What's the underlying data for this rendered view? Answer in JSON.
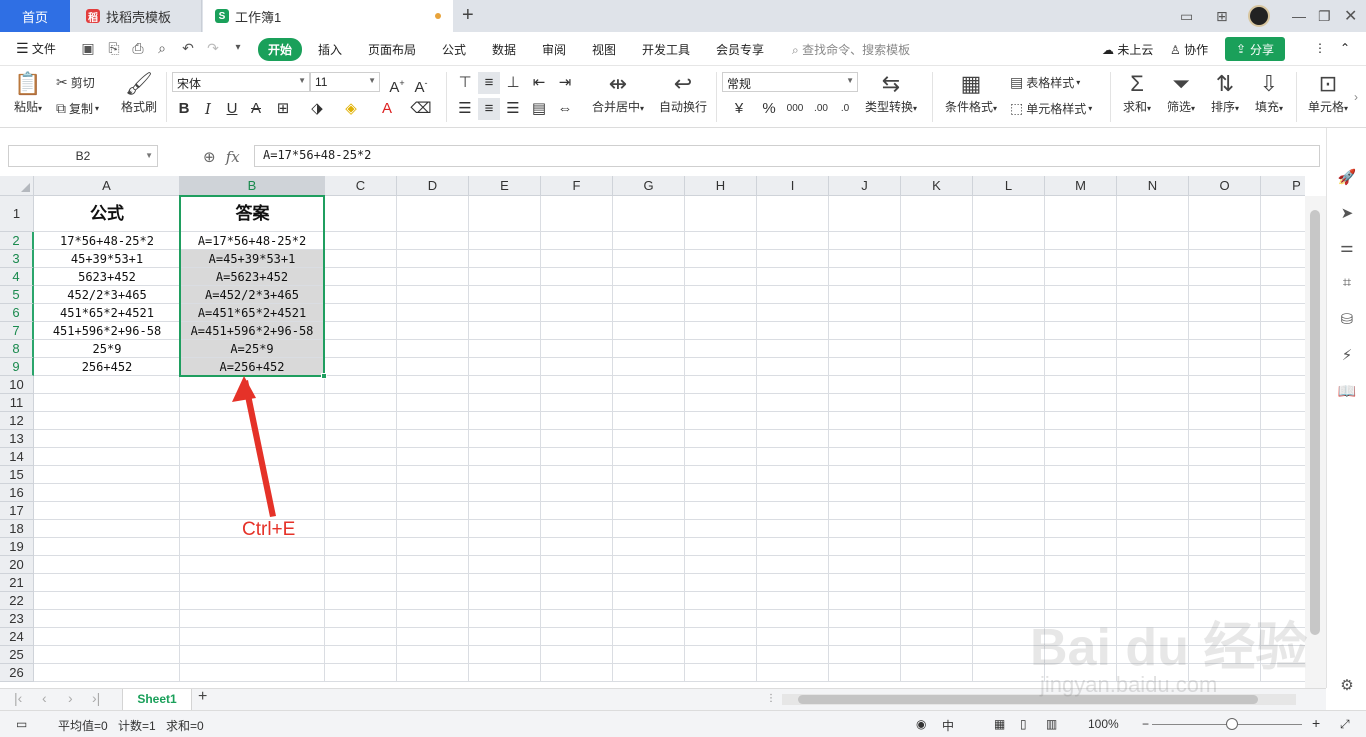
{
  "tabs": {
    "home": "首页",
    "template": "找稻壳模板",
    "workbook": "工作簿1"
  },
  "menu": {
    "file": "文件",
    "items": [
      "开始",
      "插入",
      "页面布局",
      "公式",
      "数据",
      "审阅",
      "视图",
      "开发工具",
      "会员专享"
    ],
    "search": "查找命令、搜索模板",
    "cloud": "未上云",
    "collab": "协作",
    "share": "分享"
  },
  "ribbon": {
    "paste": "粘贴",
    "cut": "剪切",
    "copy": "复制",
    "format_painter": "格式刷",
    "font_name": "宋体",
    "font_size": "11",
    "merge_center": "合并居中",
    "wrap_text": "自动换行",
    "number_format": "常规",
    "type_convert": "类型转换",
    "cond_format": "条件格式",
    "table_style": "表格样式",
    "cell_style": "单元格样式",
    "sum": "求和",
    "filter": "筛选",
    "sort": "排序",
    "fill": "填充",
    "cell": "单元格"
  },
  "formula_bar": {
    "name_box": "B2",
    "formula": "A=17*56+48-25*2"
  },
  "grid": {
    "columns": [
      "A",
      "B",
      "C",
      "D",
      "E",
      "F",
      "G",
      "H",
      "I",
      "J",
      "K",
      "L",
      "M",
      "N",
      "O",
      "P"
    ],
    "rows": [
      "1",
      "2",
      "3",
      "4",
      "5",
      "6",
      "7",
      "8",
      "9",
      "10",
      "11",
      "12",
      "13",
      "14",
      "15",
      "16",
      "17",
      "18",
      "19",
      "20",
      "21",
      "22",
      "23",
      "24",
      "25",
      "26"
    ],
    "header_a": "公式",
    "header_b": "答案",
    "col_a": [
      "17*56+48-25*2",
      "45+39*53+1",
      "5623+452",
      "452/2*3+465",
      "451*65*2+4521",
      "451+596*2+96-58",
      "25*9",
      "256+452"
    ],
    "col_b": [
      "A=17*56+48-25*2",
      "A=45+39*53+1",
      "A=5623+452",
      "A=452/2*3+465",
      "A=451*65*2+4521",
      "A=451+596*2+96-58",
      "A=25*9",
      "A=256+452"
    ]
  },
  "annotation": "Ctrl+E",
  "sheet": {
    "name": "Sheet1"
  },
  "status": {
    "average": "平均值=0",
    "count": "计数=1",
    "sum": "求和=0",
    "zoom": "100%",
    "ime": "中"
  },
  "watermark": {
    "brand": "Bai du 经验",
    "url": "jingyan.baidu.com"
  },
  "colors": {
    "accent_green": "#1aa05a",
    "home_tab_blue": "#2f6fe4",
    "annotation_red": "#e53228"
  }
}
